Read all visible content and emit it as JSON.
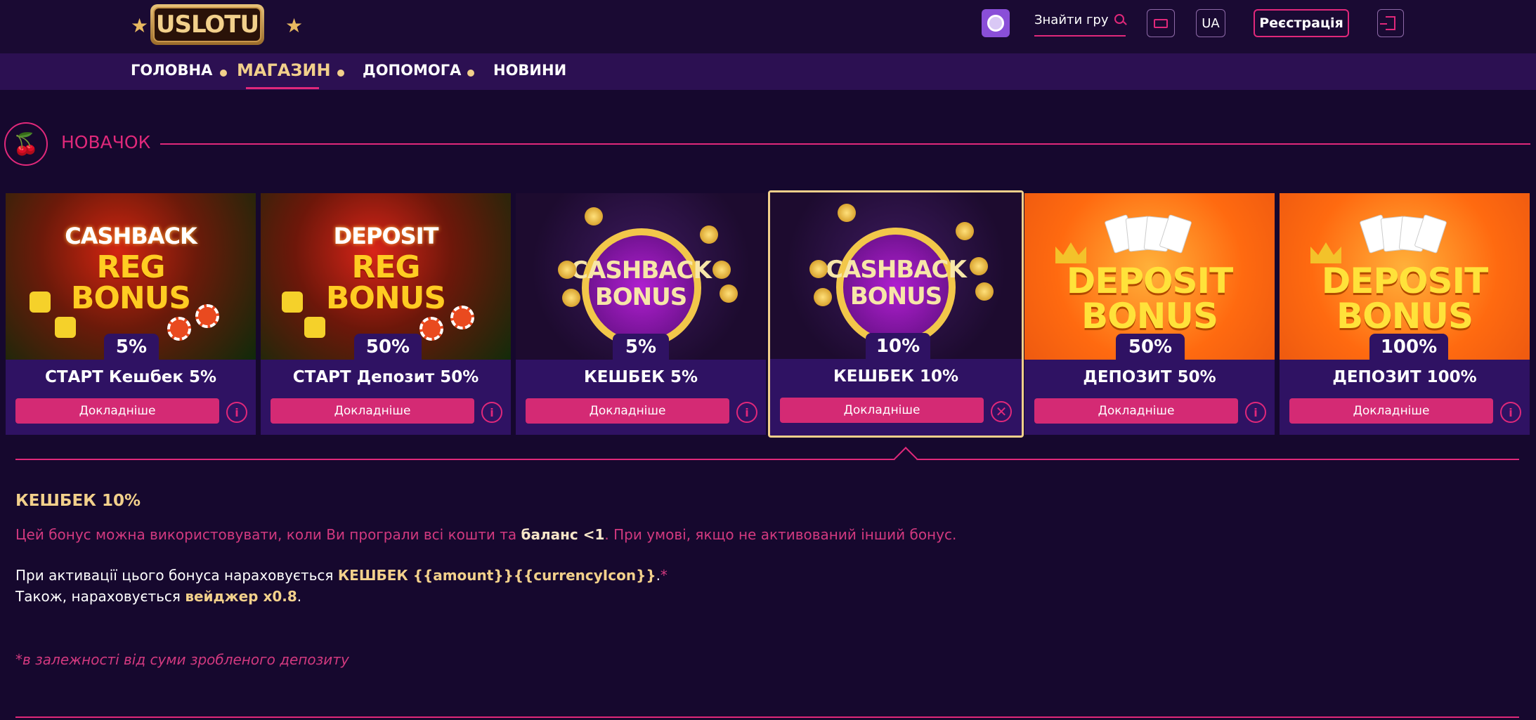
{
  "header": {
    "logo_text": "USLOTU",
    "search_placeholder": "Знайти гру",
    "lang": "UA",
    "register_label": "Реєстрація"
  },
  "nav": {
    "items": [
      "ГОЛОВНА",
      "МАГАЗИН",
      "ДОПОМОГА",
      "НОВИНИ"
    ],
    "active": "МАГАЗИН"
  },
  "section": {
    "title": "НОВАЧОК"
  },
  "cards": [
    {
      "image_lines": [
        "CASHBACK",
        "REG",
        "BONUS"
      ],
      "percent": "5%",
      "title": "СТАРТ Кешбек 5%",
      "button": "Докладніше"
    },
    {
      "image_lines": [
        "DEPOSIT",
        "REG",
        "BONUS"
      ],
      "percent": "50%",
      "title": "СТАРТ Депозит 50%",
      "button": "Докладніше"
    },
    {
      "image_lines": [
        "CASHBACK",
        "BONUS"
      ],
      "percent": "5%",
      "title": "КЕШБЕК 5%",
      "button": "Докладніше"
    },
    {
      "image_lines": [
        "CASHBACK",
        "BONUS"
      ],
      "percent": "10%",
      "title": "КЕШБЕК 10%",
      "button": "Докладніше"
    },
    {
      "image_lines": [
        "DEPOSIT",
        "BONUS"
      ],
      "percent": "50%",
      "title": "ДЕПОЗИТ 50%",
      "button": "Докладніше"
    },
    {
      "image_lines": [
        "DEPOSIT",
        "BONUS"
      ],
      "percent": "100%",
      "title": "ДЕПОЗИТ 100%",
      "button": "Докладніше"
    }
  ],
  "detail": {
    "title": "КЕШБЕК 10%",
    "line1_a": "Цей бонус можна використовувати, коли Ви програли всі кошти та ",
    "line1_b": "баланс <1",
    "line1_c": ". При умові, якщо не активований інший бонус.",
    "line2_a": "При активації цього бонуса нараховується ",
    "line2_b": "КЕШБЕК {{amount}}{{currencyIcon}}",
    "line2_c": ".",
    "line2_star": "*",
    "line3_a": "Також, нараховується ",
    "line3_b": "вейджер x0.8",
    "line3_c": ".",
    "note": "*в залежності від суми зробленого депозиту"
  },
  "colors": {
    "accent": "#e0287a",
    "gold": "#f2d08b",
    "background": "#16082e",
    "card_bg": "#2f1263"
  }
}
